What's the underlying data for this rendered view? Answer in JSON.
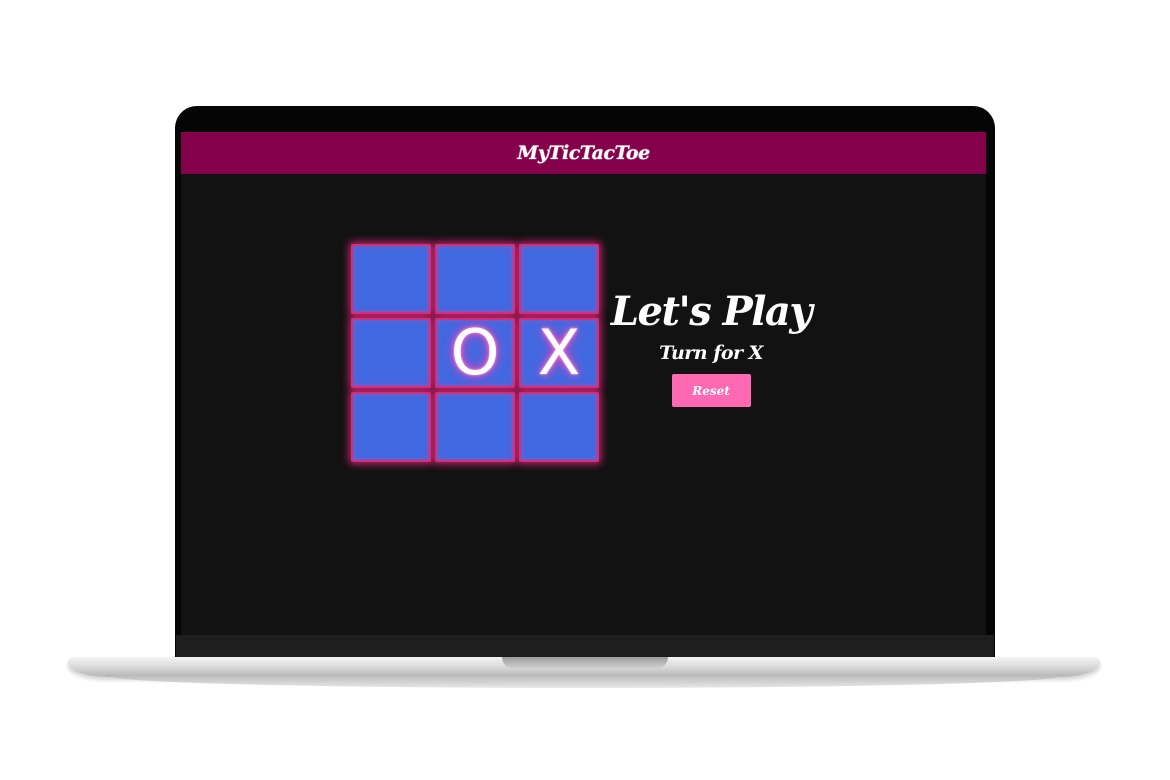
{
  "app": {
    "title": "MyTicTacToe"
  },
  "board": {
    "cells": [
      "",
      "",
      "",
      "",
      "O",
      "X",
      "",
      "",
      ""
    ]
  },
  "status": {
    "heading": "Let's Play",
    "turn_text": "Turn for X"
  },
  "controls": {
    "reset_label": "Reset"
  },
  "colors": {
    "header": "#85004a",
    "background": "#121212",
    "cell": "#4169e1",
    "cell_glow": "#ff2a8c",
    "reset_button": "#ff69b4"
  }
}
